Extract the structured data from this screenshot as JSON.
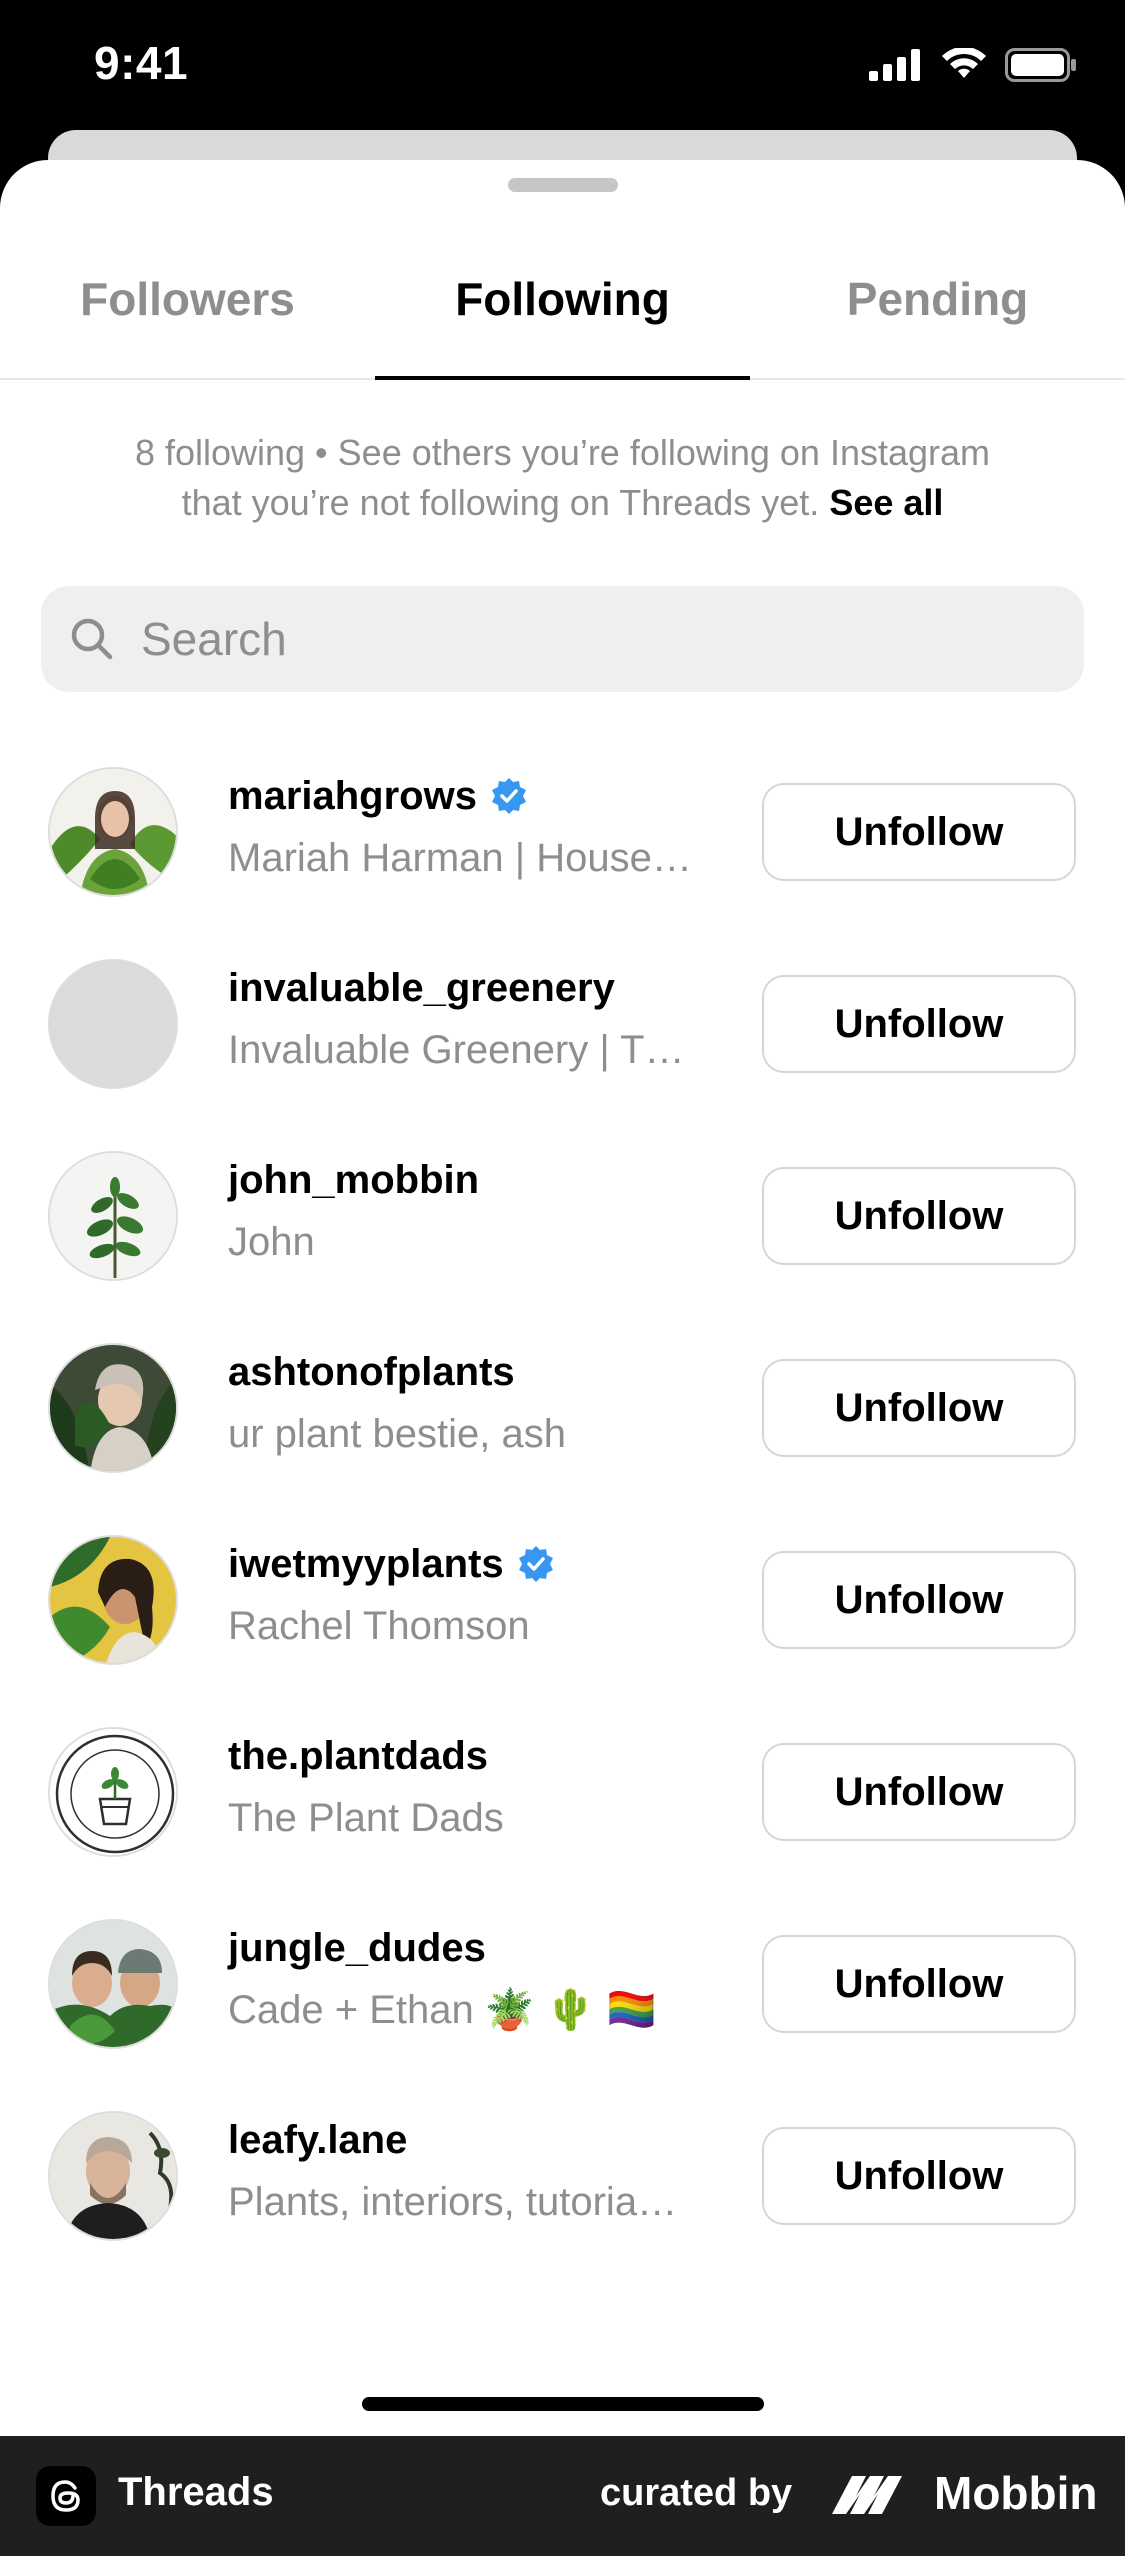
{
  "status_bar": {
    "time": "9:41"
  },
  "tabs": [
    {
      "label": "Followers"
    },
    {
      "label": "Following"
    },
    {
      "label": "Pending"
    }
  ],
  "info": {
    "line1": "8 following • See others you’re following on Instagram",
    "line2": "that you’re not following on Threads yet.",
    "see_all": "See all"
  },
  "search": {
    "placeholder": "Search"
  },
  "accounts": [
    {
      "username": "mariahgrows",
      "verified": true,
      "name": "Mariah Harman | House…",
      "button": "Unfollow"
    },
    {
      "username": "invaluable_greenery",
      "verified": false,
      "name": "Invaluable Greenery | T…",
      "button": "Unfollow"
    },
    {
      "username": "john_mobbin",
      "verified": false,
      "name": "John",
      "button": "Unfollow"
    },
    {
      "username": "ashtonofplants",
      "verified": false,
      "name": "ur plant bestie, ash",
      "button": "Unfollow"
    },
    {
      "username": "iwetmyyplants",
      "verified": true,
      "name": "Rachel Thomson",
      "button": "Unfollow"
    },
    {
      "username": "the.plantdads",
      "verified": false,
      "name": "The Plant Dads",
      "button": "Unfollow"
    },
    {
      "username": "jungle_dudes",
      "verified": false,
      "name": "Cade + Ethan 🪴 🌵 🏳️‍🌈",
      "button": "Unfollow"
    },
    {
      "username": "leafy.lane",
      "verified": false,
      "name": "Plants, interiors, tutoria…",
      "button": "Unfollow"
    }
  ],
  "footer": {
    "app_name": "Threads",
    "curated_by": "curated by",
    "brand": "Mobbin"
  }
}
